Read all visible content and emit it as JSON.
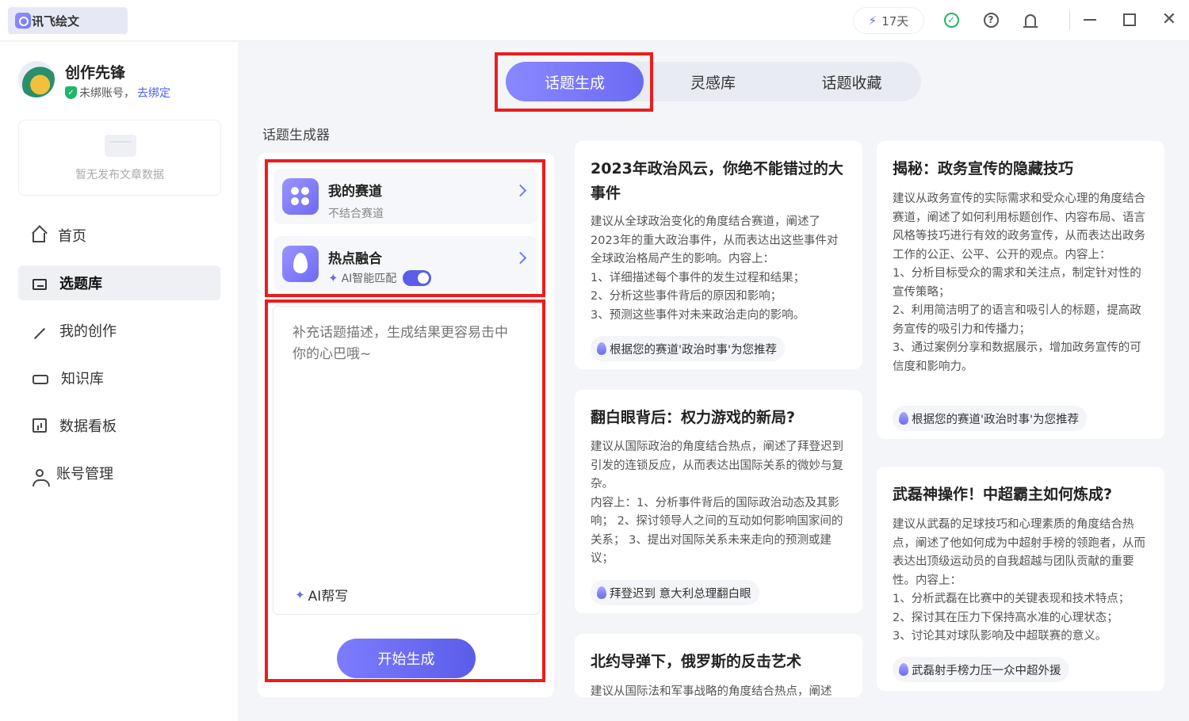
{
  "app": {
    "logo_text": "讯飞绘文",
    "days_left": "17天"
  },
  "user": {
    "name": "创作先锋",
    "bind_status": "未绑账号，",
    "bind_link": "去绑定"
  },
  "empty_state": {
    "text": "暂无发布文章数据"
  },
  "nav": [
    {
      "label": "首页",
      "icon": "home-icon",
      "active": false
    },
    {
      "label": "选题库",
      "icon": "folder-icon",
      "active": true
    },
    {
      "label": "我的创作",
      "icon": "pen-icon",
      "active": false
    },
    {
      "label": "知识库",
      "icon": "graduation-cap-icon",
      "active": false
    },
    {
      "label": "数据看板",
      "icon": "chart-board-icon",
      "active": false
    },
    {
      "label": "账号管理",
      "icon": "user-manage-icon",
      "active": false
    }
  ],
  "tabs": [
    {
      "label": "话题生成",
      "active": true
    },
    {
      "label": "灵感库",
      "active": false
    },
    {
      "label": "话题收藏",
      "active": false
    }
  ],
  "generator": {
    "section_title": "话题生成器",
    "track": {
      "title": "我的赛道",
      "subtitle": "不结合赛道"
    },
    "hot": {
      "title": "热点融合",
      "ai_match_label": "AI智能匹配",
      "toggle_on": true
    },
    "textarea_placeholder": "补充话题描述，生成结果更容易击中你的心巴哦~",
    "ai_write_label": "AI帮写",
    "start_button": "开始生成"
  },
  "cards": [
    {
      "title": "2023年政治风云，你绝不能错过的大事件",
      "body": "建议从全球政治变化的角度结合赛道，阐述了2023年的重大政治事件，从而表达出这些事件对全球政治格局产生的影响。内容上：\n1、详细描述每个事件的发生过程和结果；\n2、分析这些事件背后的原因和影响；\n3、预测这些事件对未来政治走向的影响。",
      "tag": "根据您的赛道'政治时事'为您推荐"
    },
    {
      "title": "翻白眼背后：权力游戏的新局?",
      "body": "建议从国际政治的角度结合热点，阐述了拜登迟到引发的连锁反应，从而表达出国际关系的微妙与复杂。\n内容上：1、分析事件背后的国际政治动态及其影响； 2、探讨领导人之间的互动如何影响国家间的关系； 3、提出对国际关系未来走向的预测或建议；",
      "tag": "拜登迟到 意大利总理翻白眼"
    },
    {
      "title": "北约导弹下，俄罗斯的反击艺术",
      "body": "建议从国际法和军事战略的角度结合热点，阐述",
      "tag": ""
    },
    {
      "title": "揭秘：政务宣传的隐藏技巧",
      "body": "建议从政务宣传的实际需求和受众心理的角度结合赛道，阐述了如何利用标题创作、内容布局、语言风格等技巧进行有效的政务宣传，从而表达出政务工作的公正、公平、公开的观点。内容上：\n1、分析目标受众的需求和关注点，制定针对性的宣传策略；\n2、利用简洁明了的语言和吸引人的标题，提高政务宣传的吸引力和传播力；\n3、通过案例分享和数据展示，增加政务宣传的可信度和影响力。",
      "tag": "根据您的赛道'政治时事'为您推荐"
    },
    {
      "title": "武磊神操作！中超霸主如何炼成?",
      "body": "建议从武磊的足球技巧和心理素质的角度结合热点，阐述了他如何成为中超射手榜的领跑者，从而表达出顶级运动员的自我超越与团队贡献的重要性。内容上：\n1、分析武磊在比赛中的关键表现和技术特点；\n2、探讨其在压力下保持高水准的心理状态；\n3、讨论其对球队影响及中超联赛的意义。",
      "tag": "武磊射手榜力压一众中超外援"
    }
  ]
}
